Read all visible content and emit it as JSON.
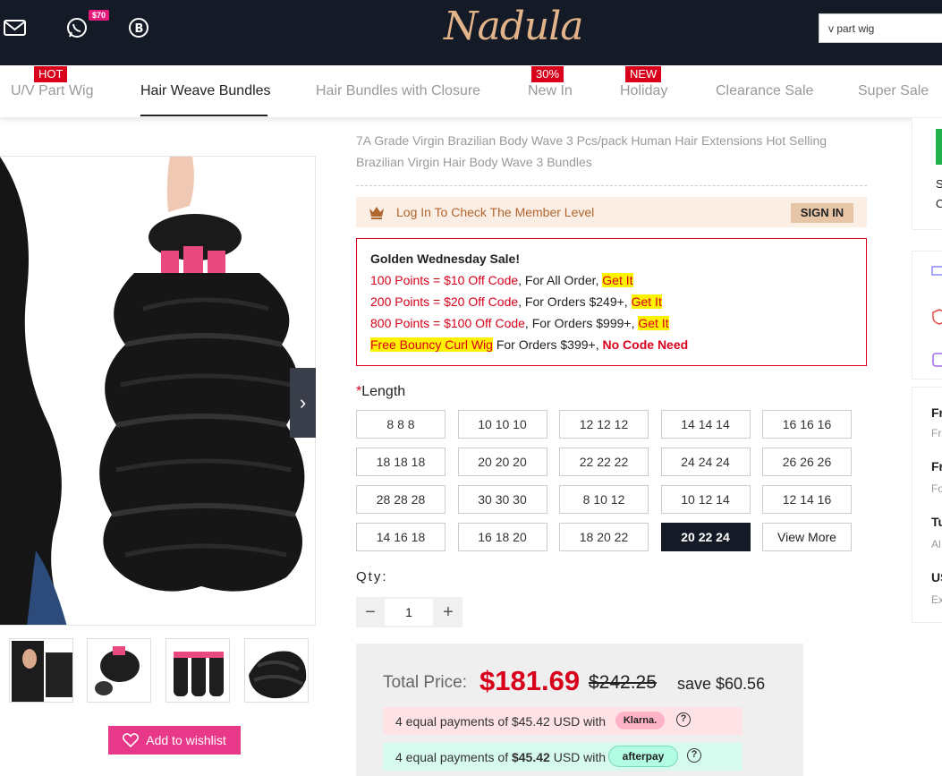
{
  "header": {
    "logo": "Nadula",
    "whatsapp_badge": "$70",
    "search_value": "v part wig",
    "colors": {
      "bg": "#141a26",
      "logo": "#e3b48a",
      "badge": "#e5197b"
    }
  },
  "nav": {
    "items": [
      {
        "label": "U/V Part Wig",
        "tag": "HOT"
      },
      {
        "label": "Hair Weave Bundles",
        "tag": ""
      },
      {
        "label": "Hair Bundles with Closure",
        "tag": ""
      },
      {
        "label": "New In",
        "tag": "30%"
      },
      {
        "label": "Holiday",
        "tag": "NEW"
      },
      {
        "label": "Clearance Sale",
        "tag": ""
      },
      {
        "label": "Super Sale",
        "tag": ""
      }
    ],
    "active_index": 1
  },
  "gallery": {
    "next_icon": "chevron-right-icon",
    "thumbnails": [
      "thumbnail-model",
      "thumbnail-single-bundle",
      "thumbnail-three-bundles",
      "thumbnail-hair-closeup"
    ],
    "wishlist_label": "Add to wishlist"
  },
  "product": {
    "title": "7A Grade Virgin Brazilian Body Wave 3 Pcs/pack Human Hair Extensions Hot Selling Brazilian Virgin Hair Body Wave 3 Bundles"
  },
  "member": {
    "text": "Log In To Check The Member Level",
    "signin": "SIGN IN"
  },
  "promo": {
    "title": "Golden Wednesday Sale!",
    "lines": [
      {
        "offer": "100 Points = $10 Off Code",
        "cond": ", For All Order, ",
        "link": "Get It"
      },
      {
        "offer": "200 Points = $20 Off Code",
        "cond": ", For Orders $249+, ",
        "link": "Get It"
      },
      {
        "offer": "800 Points = $100 Off Code",
        "cond": ", For Orders $999+, ",
        "link": "Get It"
      }
    ],
    "free_gift": "Free Bouncy Curl Wig",
    "free_cond": " For Orders $399+, ",
    "free_note": "No Code Need"
  },
  "length": {
    "required_mark": "*",
    "label": "Length",
    "options": [
      "8 8 8",
      "10 10 10",
      "12 12 12",
      "14 14 14",
      "16 16 16",
      "18 18 18",
      "20 20 20",
      "22 22 22",
      "24 24 24",
      "26 26 26",
      "28 28 28",
      "30 30 30",
      "8 10 12",
      "10 12 14",
      "12 14 16",
      "14 16 18",
      "16 18 20",
      "18 20 22",
      "20 22 24",
      "View More"
    ],
    "selected": "20 22 24"
  },
  "quantity": {
    "label": "Qty:",
    "value": "1",
    "minus": "−",
    "plus": "+"
  },
  "price": {
    "label": "Total Price:",
    "current": "$181.69",
    "original": "$242.25",
    "save": "save $60.56",
    "klarna_text_pre": "4 equal payments of $45.42 USD with",
    "klarna_logo": "Klarna.",
    "afterpay_text_pre": "4 equal payments of ",
    "afterpay_amount": "$45.42",
    "afterpay_text_post": " USD with",
    "afterpay_logo": "afterpay",
    "help": "?"
  },
  "side_panel": {
    "top_letters": [
      "S",
      "C"
    ],
    "feature_titles": [
      "Fr",
      "Fr",
      "Tu",
      "US"
    ],
    "feature_subs": [
      "Fr",
      "Fo",
      "Al",
      "Ex"
    ]
  }
}
